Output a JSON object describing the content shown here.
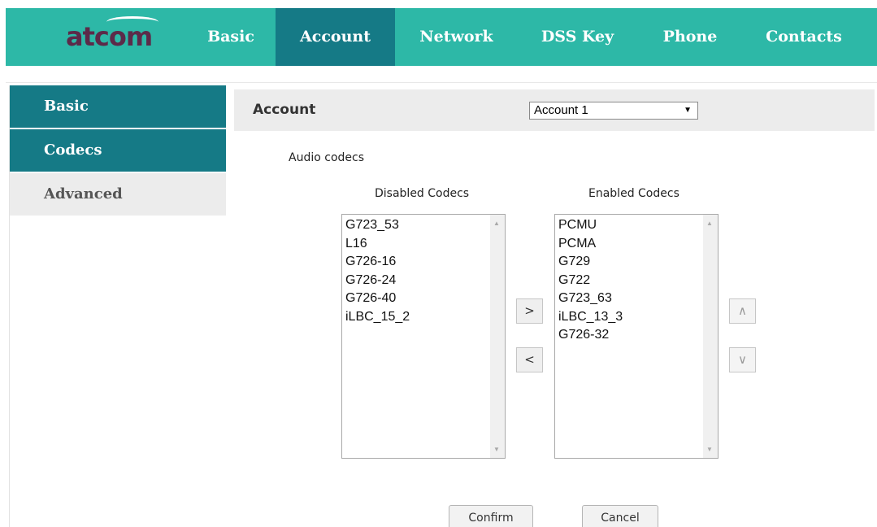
{
  "logo": {
    "text": "atcom"
  },
  "nav": {
    "tabs": [
      {
        "label": "Basic"
      },
      {
        "label": "Account"
      },
      {
        "label": "Network"
      },
      {
        "label": "DSS Key"
      },
      {
        "label": "Phone"
      },
      {
        "label": "Contacts"
      }
    ],
    "active": "Account"
  },
  "sidebar": {
    "items": [
      {
        "label": "Basic"
      },
      {
        "label": "Codecs"
      },
      {
        "label": "Advanced"
      }
    ],
    "active": "Codecs"
  },
  "account_bar": {
    "label": "Account",
    "selected": "Account 1"
  },
  "section_title": "Audio codecs",
  "disabled": {
    "title": "Disabled Codecs",
    "items": [
      "G723_53",
      "L16",
      "G726-16",
      "G726-24",
      "G726-40",
      "iLBC_15_2"
    ]
  },
  "enabled": {
    "title": "Enabled Codecs",
    "items": [
      "PCMU",
      "PCMA",
      "G729",
      "G722",
      "G723_63",
      "iLBC_13_3",
      "G726-32"
    ]
  },
  "move_buttons": {
    "right": ">",
    "left": "<",
    "up": "∧",
    "down": "∨"
  },
  "actions": {
    "confirm": "Confirm",
    "cancel": "Cancel"
  },
  "colors": {
    "teal": "#2db8a7",
    "dark_teal": "#157a86",
    "logo": "#5c2a49"
  }
}
